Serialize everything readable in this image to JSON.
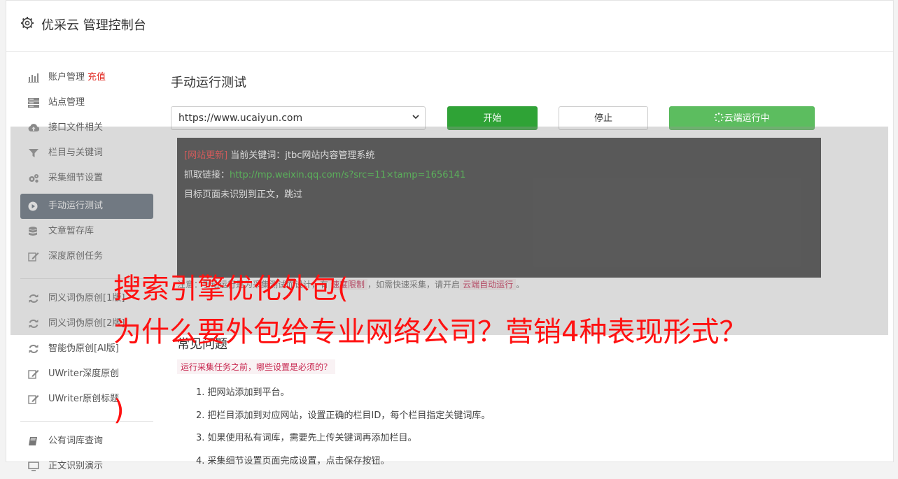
{
  "header": {
    "title": "优采云 管理控制台",
    "icon": "gear-icon"
  },
  "sidebar": {
    "group1": [
      {
        "label": "账户管理",
        "badge": "充值",
        "icon": "bar-chart-icon"
      },
      {
        "label": "站点管理",
        "icon": "server-icon"
      },
      {
        "label": "接口文件相关",
        "icon": "cloud-upload-icon"
      },
      {
        "label": "栏目与关键词",
        "icon": "filter-icon"
      },
      {
        "label": "采集细节设置",
        "icon": "cogs-icon"
      },
      {
        "label": "手动运行测试",
        "icon": "play-circle-icon",
        "active": true
      },
      {
        "label": "文章暂存库",
        "icon": "database-icon"
      },
      {
        "label": "深度原创任务",
        "icon": "edit-icon"
      }
    ],
    "group2": [
      {
        "label": "同义词伪原创[1版]",
        "icon": "refresh-icon"
      },
      {
        "label": "同义词伪原创[2版]",
        "icon": "refresh-icon"
      },
      {
        "label": "智能伪原创[AI版]",
        "icon": "refresh-icon"
      },
      {
        "label": "UWriter深度原创",
        "icon": "edit-icon"
      },
      {
        "label": "UWriter原创标题",
        "icon": "edit-icon"
      }
    ],
    "group3": [
      {
        "label": "公有词库查询",
        "icon": "book-icon"
      },
      {
        "label": "正文识别演示",
        "icon": "monitor-icon"
      }
    ]
  },
  "main": {
    "title": "手动运行测试",
    "select_value": "https://www.ucaiyun.com",
    "start_label": "开始",
    "stop_label": "停止",
    "cloud_label": "云端运行中",
    "console": {
      "line1_tag": "[网站更新]",
      "line1_text": " 当前关键词：jtbc网站内容管理系统",
      "line2_label": "抓取链接：",
      "line2_link": "http://mp.weixin.qq.com/s?src=11×tamp=1656141",
      "line3": "目标页面未识别到正文，跳过"
    },
    "note": {
      "prefix": "注意：",
      "mid": "手动运行是为采集测试而设计，有",
      "code1": "速度限制",
      "mid2": "，如需快速采集，请开启",
      "code2": "云端自动运行",
      "end": "。"
    },
    "faq": {
      "title": "常见问题",
      "question": "运行采集任务之前，哪些设置是必须的？",
      "items": [
        "1. 把网站添加到平台。",
        "2. 把栏目添加到对应网站，设置正确的栏目ID，每个栏目指定关键词库。",
        "3. 如果使用私有词库，需要先上传关键词再添加栏目。",
        "4. 采集细节设置页面完成设置，点击保存按钮。"
      ]
    }
  },
  "watermark": {
    "line1": "搜索引擎优化外包(",
    "line2": "为什么要外包给专业网络公司？营销4种表现形式？",
    "line3": ")"
  }
}
